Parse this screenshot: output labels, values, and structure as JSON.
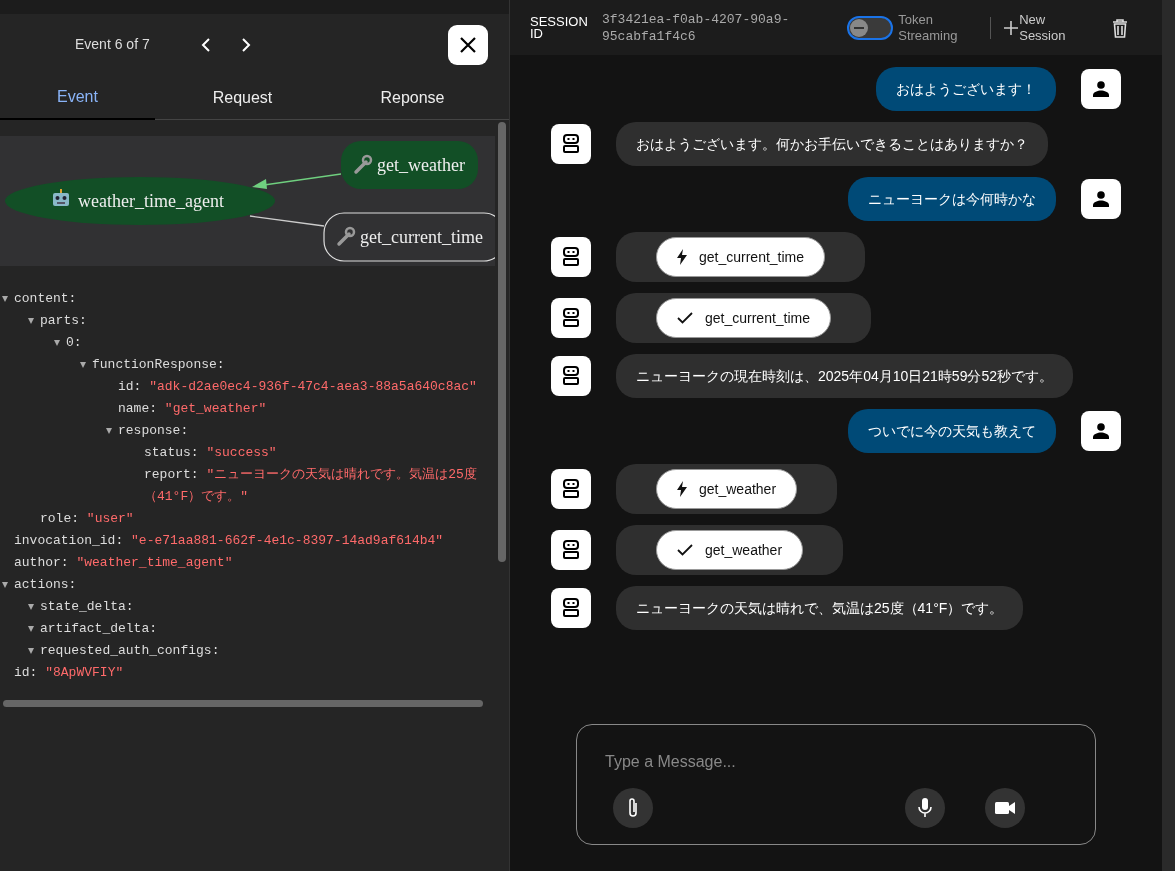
{
  "event_panel": {
    "counter": "Event 6 of 7",
    "tabs": [
      {
        "label": "Event",
        "selected": true
      },
      {
        "label": "Request",
        "selected": false
      },
      {
        "label": "Reponse",
        "selected": false
      }
    ],
    "graph": {
      "nodes": [
        {
          "label": "get_weather",
          "kind": "tool",
          "active": true
        },
        {
          "label": "weather_time_agent",
          "kind": "agent",
          "active": true
        },
        {
          "label": "get_current_time",
          "kind": "tool",
          "active": false
        }
      ]
    },
    "tree": [
      {
        "key": "content:",
        "expanded": true,
        "children": [
          {
            "key": "parts:",
            "expanded": true,
            "children": [
              {
                "key": "0:",
                "expanded": true,
                "children": [
                  {
                    "key": "functionResponse:",
                    "expanded": true,
                    "children": [
                      {
                        "key": "id:",
                        "value": "\"adk-d2ae0ec4-936f-47c4-aea3-88a5a640c8ac\""
                      },
                      {
                        "key": "name:",
                        "value": "\"get_weather\""
                      },
                      {
                        "key": "response:",
                        "expanded": true,
                        "children": [
                          {
                            "key": "status:",
                            "value": "\"success\""
                          },
                          {
                            "key": "report:",
                            "value": "\"ニューヨークの天気は晴れです。気温は25度（41°F）です。\""
                          }
                        ]
                      }
                    ]
                  }
                ]
              }
            ]
          },
          {
            "key": "role:",
            "value": "\"user\""
          }
        ]
      },
      {
        "key": "invocation_id:",
        "value": "\"e-e71aa881-662f-4e1c-8397-14ad9af614b4\""
      },
      {
        "key": "author:",
        "value": "\"weather_time_agent\""
      },
      {
        "key": "actions:",
        "expanded": true,
        "children": [
          {
            "key": "state_delta:",
            "expanded": true
          },
          {
            "key": "artifact_delta:",
            "expanded": true
          },
          {
            "key": "requested_auth_configs:",
            "expanded": true
          }
        ]
      },
      {
        "key": "id:",
        "value": "\"8ApWVFIY\""
      }
    ]
  },
  "chat_header": {
    "session_label": "SESSION ID",
    "session_id": "3f3421ea-f0ab-4207-90a9-95cabfa1f4c6",
    "token_streaming": {
      "label": "Token Streaming",
      "on": false
    },
    "new_session": "New Session"
  },
  "messages": [
    {
      "kind": "user",
      "text": "おはようございます！"
    },
    {
      "kind": "agent",
      "text": "おはようございます。何かお手伝いできることはありますか？"
    },
    {
      "kind": "user",
      "text": "ニューヨークは今何時かな"
    },
    {
      "kind": "call",
      "text": "get_current_time"
    },
    {
      "kind": "result",
      "text": "get_current_time"
    },
    {
      "kind": "agent",
      "text": "ニューヨークの現在時刻は、2025年04月10日21時59分52秒です。"
    },
    {
      "kind": "user",
      "text": "ついでに今の天気も教えて"
    },
    {
      "kind": "call",
      "text": "get_weather"
    },
    {
      "kind": "result",
      "text": "get_weather"
    },
    {
      "kind": "agent",
      "text": "ニューヨークの天気は晴れで、気温は25度（41°F）です。"
    }
  ],
  "composer": {
    "placeholder": "Type a Message..."
  }
}
